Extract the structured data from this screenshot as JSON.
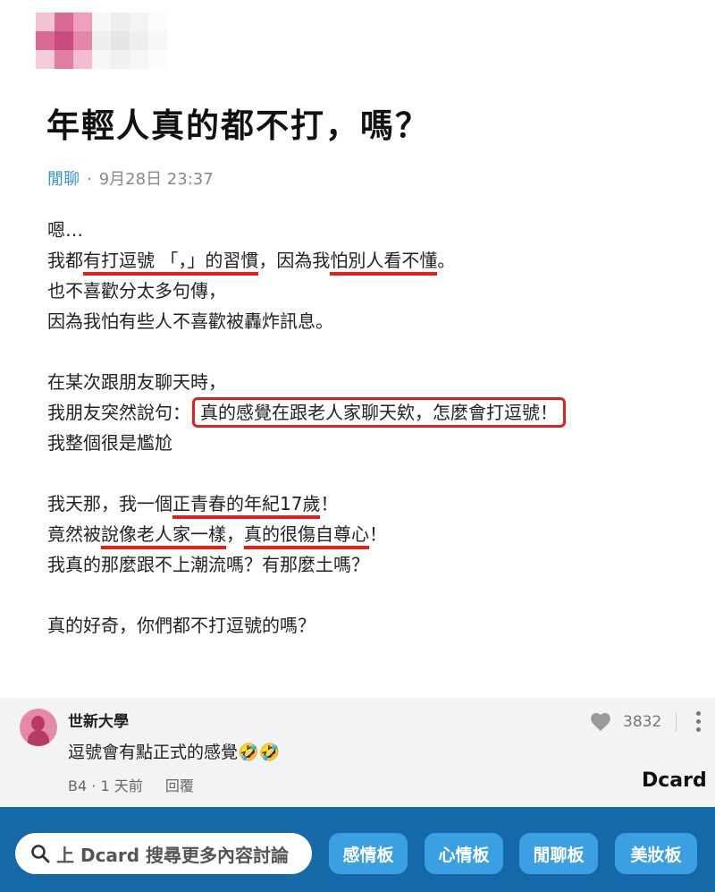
{
  "post": {
    "title": "年輕人真的都不打，嗎？",
    "board": "閒聊",
    "separator": "·",
    "date": "9月28日 23:37",
    "lines": {
      "l1": "嗯…",
      "l2a": "我都",
      "l2b": "有打逗號 「，」的習慣",
      "l2c": "，因為我",
      "l2d": "怕別人看不懂",
      "l2e": "。",
      "l3": "也不喜歡分太多句傳，",
      "l4": "因為我怕有些人不喜歡被轟炸訊息。",
      "l5": "在某次跟朋友聊天時，",
      "l6a": "我朋友突然說句：",
      "l6b": "真的感覺在跟老人家聊天欸，怎麼會打逗號！",
      "l7": "我整個很是尷尬",
      "l8a": "我天那，我一個",
      "l8b": "正青春的年紀17歲",
      "l8c": "！",
      "l9a": "竟然被",
      "l9b": "說像老人家一樣",
      "l9c": "，",
      "l9d": "真的很傷自尊心",
      "l9e": "！",
      "l10": "我真的那麼跟不上潮流嗎？有那麼土嗎？",
      "l11": "真的好奇，你們都不打逗號的嗎？"
    }
  },
  "comment": {
    "school": "世新大學",
    "text": "逗號會有點正式的感覺🤣🤣",
    "floor": "B4",
    "dot": "·",
    "time": "1 天前",
    "reply": "回覆",
    "likes": "3832",
    "like_icon": "heart-icon",
    "more_icon": "more-vertical-icon"
  },
  "brand": {
    "logo": "Dcard"
  },
  "bottom_bar": {
    "search_placeholder": "上 Dcard 搜尋更多內容討論",
    "search_icon": "search-icon",
    "tags": [
      "感情板",
      "心情板",
      "閒聊板",
      "美妝板"
    ]
  },
  "colors": {
    "accent_blue": "#3397cf",
    "bar_bg": "#1669a8",
    "tag_bg": "#3aa0e1",
    "highlight_red": "#e2211c",
    "comment_bg": "#f2f3f4"
  }
}
